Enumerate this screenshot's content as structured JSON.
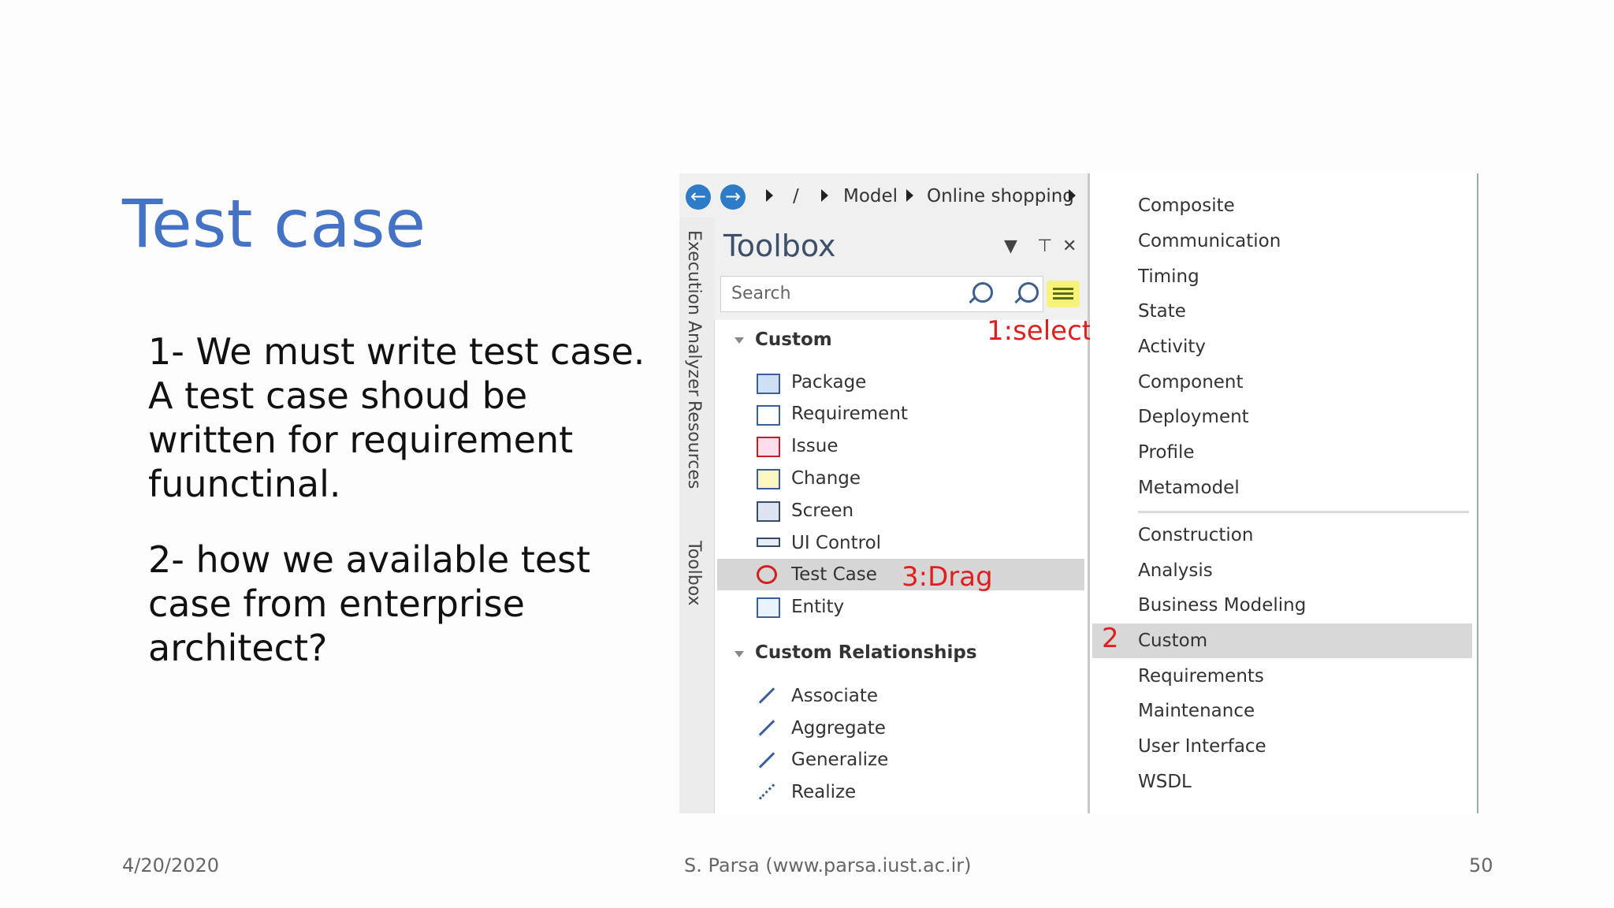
{
  "slide": {
    "title": "Test case",
    "paragraph1": "1- We must write test case. A test case shoud be written for requirement fuunctinal.",
    "paragraph2": "2- how we available test case from enterprise architect?",
    "footer_date": "4/20/2020",
    "footer_author": "S. Parsa (www.parsa.iust.ac.ir)",
    "footer_page": "50"
  },
  "screenshot": {
    "breadcrumb": {
      "root": "/",
      "model": "Model",
      "package": "Online shopping"
    },
    "vertical_tabs": [
      "Execution Analyzer",
      "Resources",
      "Toolbox"
    ],
    "toolbox": {
      "title": "Toolbox",
      "search_placeholder": "Search",
      "group_custom": "Custom",
      "items": [
        "Package",
        "Requirement",
        "Issue",
        "Change",
        "Screen",
        "UI Control",
        "Test Case",
        "Entity"
      ],
      "group_relationships": "Custom Relationships",
      "relationships": [
        "Associate",
        "Aggregate",
        "Generalize",
        "Realize"
      ]
    },
    "annotations": {
      "select": "1:select",
      "custom_num": "2",
      "drag": "3:Drag"
    },
    "menu": {
      "items_top": [
        "Composite",
        "Communication",
        "Timing",
        "State",
        "Activity",
        "Component",
        "Deployment",
        "Profile",
        "Metamodel"
      ],
      "items_bottom": [
        "Construction",
        "Analysis",
        "Business Modeling",
        "Custom",
        "Requirements",
        "Maintenance",
        "User Interface",
        "WSDL"
      ]
    }
  },
  "colors": {
    "title": "#4472c4",
    "annotation": "#e0201f",
    "highlight": "#f6f27a",
    "selected_row": "#d6d6d6"
  }
}
